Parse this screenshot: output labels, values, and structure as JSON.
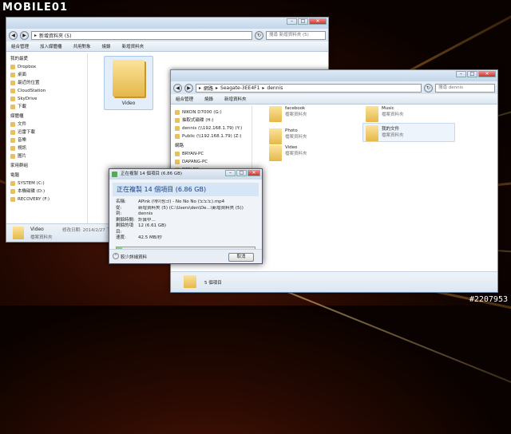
{
  "watermark": "MOBILE01",
  "credit": "#2207953",
  "back_window": {
    "address": [
      "新增資料夾 (5)"
    ],
    "search_placeholder": "搜尋 新增資料夾 (5)",
    "commands": [
      "組合管理",
      "加入媒體櫃",
      "共用對象",
      "燒錄",
      "新增資料夾"
    ],
    "sidebar": [
      {
        "label": "我的最愛",
        "header": true
      },
      {
        "label": "Dropbox"
      },
      {
        "label": "桌面"
      },
      {
        "label": "最近的位置"
      },
      {
        "label": "CloudStation"
      },
      {
        "label": "SkyDrive"
      },
      {
        "label": "下載"
      },
      {
        "label": "媒體櫃",
        "header": true
      },
      {
        "label": "文件"
      },
      {
        "label": "迅雷下載"
      },
      {
        "label": "音樂"
      },
      {
        "label": "視訊"
      },
      {
        "label": "圖片"
      },
      {
        "label": "家用群組",
        "header": true
      },
      {
        "label": "電腦",
        "header": true
      },
      {
        "label": "SYSTEM (C:)"
      },
      {
        "label": "本機磁碟 (D:)"
      },
      {
        "label": "RECOVERY (F:)"
      }
    ],
    "folder_label": "Video",
    "status": {
      "name": "Video",
      "modified_label": "修改日期: 2014/2/27 下午 06:50",
      "type": "檔案資料夾"
    }
  },
  "front_window": {
    "address": [
      "網路",
      "Seagate-3EE4F1",
      "dennis"
    ],
    "search_placeholder": "搜尋 dennis",
    "commands": [
      "組合管理",
      "燒錄",
      "新增資料夾"
    ],
    "sidebar": [
      {
        "label": "NIKON D7000 (G:)"
      },
      {
        "label": "抽取式磁碟 (H:)"
      },
      {
        "label": "dennis (\\\\192.168.1.79) (Y:)"
      },
      {
        "label": "Public (\\\\192.168.1.79) (Z:)"
      },
      {
        "label": "網路",
        "header": true
      },
      {
        "label": "BRYAN-PC"
      },
      {
        "label": "DAPANG-PC"
      },
      {
        "label": "DEN-PC"
      }
    ],
    "items": [
      {
        "name": "facebook",
        "sub": "檔案資料夾"
      },
      {
        "name": "Music",
        "sub": "檔案資料夾"
      },
      {
        "name": "Photo",
        "sub": "檔案資料夾"
      },
      {
        "name": "我的文件",
        "sub": "檔案資料夾"
      },
      {
        "name": "Video",
        "sub": "檔案資料夾"
      }
    ],
    "status_count": "5 個項目"
  },
  "copy_dialog": {
    "title": "正在複製 14 個項目 (6.86 GB)",
    "heading": "正在複製 14 個項目 (6.86 GB)",
    "rows": [
      {
        "k": "名稱:",
        "v": "APink (에이핑크) - No No No (노노노).mp4"
      },
      {
        "k": "從:",
        "v": "新增資料夾 (5) (C:\\Users\\den\\De...\\新增資料夾 (5))"
      },
      {
        "k": "到:",
        "v": "dennis"
      },
      {
        "k": "剩餘時間:",
        "v": "計算中..."
      },
      {
        "k": "剩餘的項目:",
        "v": "12 (6.61 GB)"
      },
      {
        "k": "速度:",
        "v": "42.5 MB/秒"
      }
    ],
    "progress": 0.04,
    "less_detail": "較少詳細資料",
    "cancel": "取消"
  }
}
